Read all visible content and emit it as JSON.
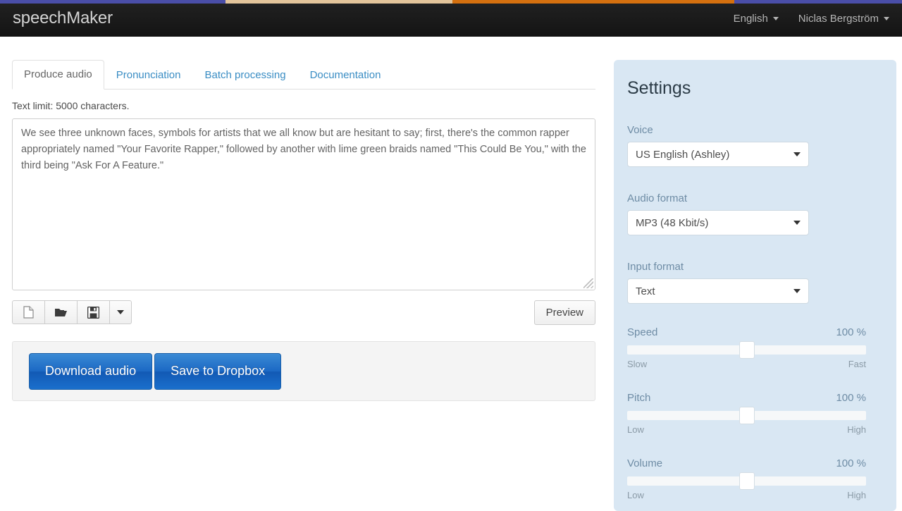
{
  "progress": {
    "segments": [
      "#4a4ea8",
      "#e3c59b",
      "#d4700f",
      "#4a4ea8"
    ]
  },
  "navbar": {
    "brand": "speechMaker",
    "language": "English",
    "user": "Niclas Bergström",
    "caret_icon": "chevron-down-icon"
  },
  "tabs": [
    {
      "label": "Produce audio",
      "active": true
    },
    {
      "label": "Pronunciation",
      "active": false
    },
    {
      "label": "Batch processing",
      "active": false
    },
    {
      "label": "Documentation",
      "active": false
    }
  ],
  "editor": {
    "text_limit": "Text limit: 5000 characters.",
    "value": "We see three unknown faces, symbols for artists that we all know but are hesitant to say; first, there's the common rapper appropriately named \"Your Favorite Rapper,\" followed by another with lime green braids named \"This Could Be You,\" with the third being \"Ask For A Feature.\"",
    "placeholder": ""
  },
  "toolbar": {
    "new_icon": "new-document-icon",
    "open_icon": "open-folder-icon",
    "save_icon": "save-floppy-icon",
    "more_icon": "chevron-down-icon",
    "preview_label": "Preview"
  },
  "actions": {
    "download_label": "Download audio",
    "dropbox_label": "Save to Dropbox",
    "accent_color": "#1b68c4"
  },
  "settings": {
    "title": "Settings",
    "panel_color": "#d9e7f3",
    "label_color": "#6e8ca5",
    "voice": {
      "label": "Voice",
      "value": "US English (Ashley)"
    },
    "audio_format": {
      "label": "Audio format",
      "value": "MP3 (48 Kbit/s)"
    },
    "input_format": {
      "label": "Input format",
      "value": "Text"
    },
    "sliders": [
      {
        "name": "Speed",
        "value": "100 %",
        "min_label": "Slow",
        "max_label": "Fast",
        "position": 50
      },
      {
        "name": "Pitch",
        "value": "100 %",
        "min_label": "Low",
        "max_label": "High",
        "position": 50
      },
      {
        "name": "Volume",
        "value": "100 %",
        "min_label": "Low",
        "max_label": "High",
        "position": 50
      }
    ]
  }
}
